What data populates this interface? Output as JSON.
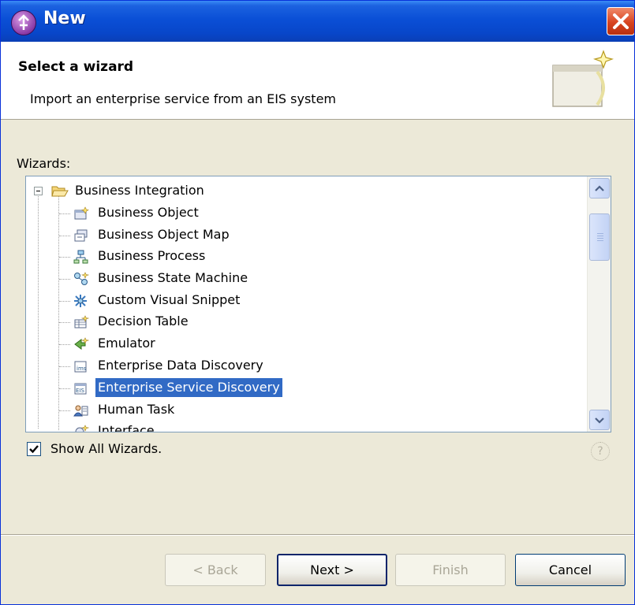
{
  "window": {
    "title": "New"
  },
  "header": {
    "title": "Select a wizard",
    "description": "Import an enterprise service from an EIS system"
  },
  "wizards_label": "Wizards:",
  "tree": {
    "root": {
      "label": "Business Integration",
      "icon": "folder-open-icon",
      "expanded": true
    },
    "items": [
      {
        "label": "Business Object",
        "icon": "business-object-icon",
        "selected": false
      },
      {
        "label": "Business Object Map",
        "icon": "business-object-map-icon",
        "selected": false
      },
      {
        "label": "Business Process",
        "icon": "business-process-icon",
        "selected": false
      },
      {
        "label": "Business State Machine",
        "icon": "state-machine-icon",
        "selected": false
      },
      {
        "label": "Custom Visual Snippet",
        "icon": "visual-snippet-icon",
        "selected": false
      },
      {
        "label": "Decision Table",
        "icon": "decision-table-icon",
        "selected": false
      },
      {
        "label": "Emulator",
        "icon": "emulator-icon",
        "selected": false
      },
      {
        "label": "Enterprise Data Discovery",
        "icon": "data-discovery-icon",
        "selected": false
      },
      {
        "label": "Enterprise Service Discovery",
        "icon": "eis-discovery-icon",
        "selected": true
      },
      {
        "label": "Human Task",
        "icon": "human-task-icon",
        "selected": false
      },
      {
        "label": "Interface",
        "icon": "interface-icon",
        "selected": false
      }
    ]
  },
  "show_all": {
    "label": "Show All Wizards.",
    "checked": true
  },
  "buttons": {
    "back": "< Back",
    "next": "Next >",
    "finish": "Finish",
    "cancel": "Cancel"
  },
  "colors": {
    "titlebar": "#0a4fd6",
    "selection": "#316ac5",
    "dialog_bg": "#ece9d8"
  }
}
